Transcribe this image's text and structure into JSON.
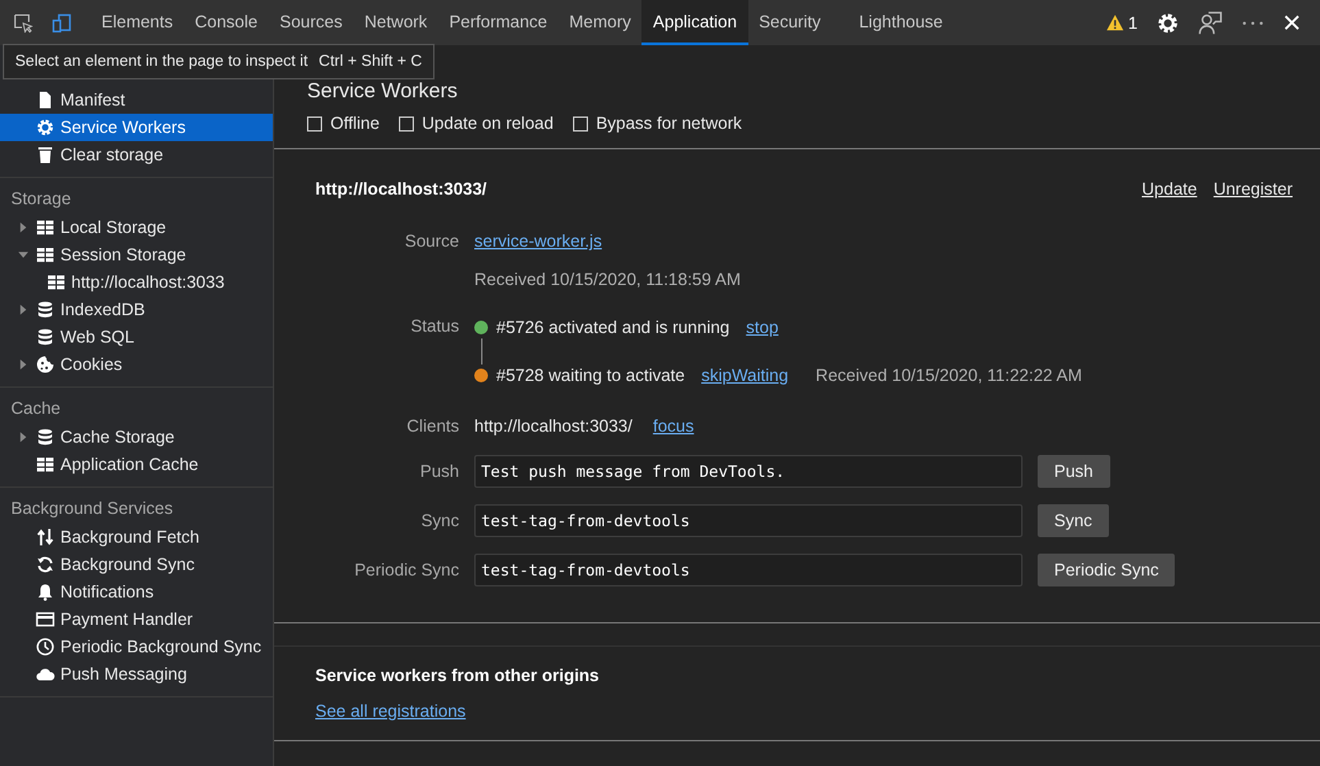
{
  "toolbar": {
    "tabs": [
      {
        "label": "Elements",
        "selected": false
      },
      {
        "label": "Console",
        "selected": false
      },
      {
        "label": "Sources",
        "selected": false
      },
      {
        "label": "Network",
        "selected": false
      },
      {
        "label": "Performance",
        "selected": false
      },
      {
        "label": "Memory",
        "selected": false
      },
      {
        "label": "Application",
        "selected": true
      },
      {
        "label": "Security",
        "selected": false
      },
      {
        "label": "Lighthouse",
        "selected": false
      }
    ],
    "warning_count": "1"
  },
  "tooltip": {
    "text": "Select an element in the page to inspect it",
    "shortcut": "Ctrl + Shift + C"
  },
  "sidebar": {
    "sections": [
      {
        "items": [
          {
            "label": "Manifest",
            "kind": "file",
            "selected": false
          },
          {
            "label": "Service Workers",
            "kind": "gear",
            "selected": true
          },
          {
            "label": "Clear storage",
            "kind": "trash",
            "selected": false
          }
        ]
      },
      {
        "header": "Storage",
        "items": [
          {
            "label": "Local Storage",
            "kind": "grid",
            "selected": false,
            "expanded": false
          },
          {
            "label": "Session Storage",
            "kind": "grid",
            "selected": false,
            "expanded": true,
            "children": [
              {
                "label": "http://localhost:3033",
                "kind": "grid",
                "selected": false
              }
            ]
          },
          {
            "label": "IndexedDB",
            "kind": "db",
            "selected": false,
            "expanded": false
          },
          {
            "label": "Web SQL",
            "kind": "db",
            "selected": false
          },
          {
            "label": "Cookies",
            "kind": "cookie",
            "selected": false,
            "expanded": false
          }
        ]
      },
      {
        "header": "Cache",
        "items": [
          {
            "label": "Cache Storage",
            "kind": "db",
            "selected": false,
            "expanded": false
          },
          {
            "label": "Application Cache",
            "kind": "grid",
            "selected": false
          }
        ]
      },
      {
        "header": "Background Services",
        "items": [
          {
            "label": "Background Fetch",
            "kind": "updown",
            "selected": false
          },
          {
            "label": "Background Sync",
            "kind": "sync",
            "selected": false
          },
          {
            "label": "Notifications",
            "kind": "bell",
            "selected": false
          },
          {
            "label": "Payment Handler",
            "kind": "card",
            "selected": false
          },
          {
            "label": "Periodic Background Sync",
            "kind": "clock",
            "selected": false
          },
          {
            "label": "Push Messaging",
            "kind": "cloud",
            "selected": false
          }
        ]
      }
    ]
  },
  "main": {
    "title": "Service Workers",
    "options": [
      {
        "label": "Offline",
        "checked": false
      },
      {
        "label": "Update on reload",
        "checked": false
      },
      {
        "label": "Bypass for network",
        "checked": false
      }
    ],
    "registration": {
      "origin": "http://localhost:3033/",
      "actions": [
        "Update",
        "Unregister"
      ],
      "source_label": "Source",
      "source": "service-worker.js",
      "source_received": "Received 10/15/2020, 11:18:59 AM",
      "status_label": "Status",
      "status": [
        {
          "text": "#5726 activated and is running",
          "action": "stop",
          "color": "#5fb35c"
        },
        {
          "text": "#5728 waiting to activate",
          "action": "skipWaiting",
          "color": "#e2831c",
          "received": "Received 10/15/2020, 11:22:22 AM"
        }
      ],
      "clients_label": "Clients",
      "client": "http://localhost:3033/",
      "client_action": "focus",
      "messages": [
        {
          "label": "Push",
          "value": "Test push message from DevTools.",
          "button": "Push"
        },
        {
          "label": "Sync",
          "value": "test-tag-from-devtools",
          "button": "Sync"
        },
        {
          "label": "Periodic Sync",
          "value": "test-tag-from-devtools",
          "button": "Periodic Sync"
        }
      ]
    },
    "other": {
      "title": "Service workers from other origins",
      "link": "See all registrations"
    }
  }
}
